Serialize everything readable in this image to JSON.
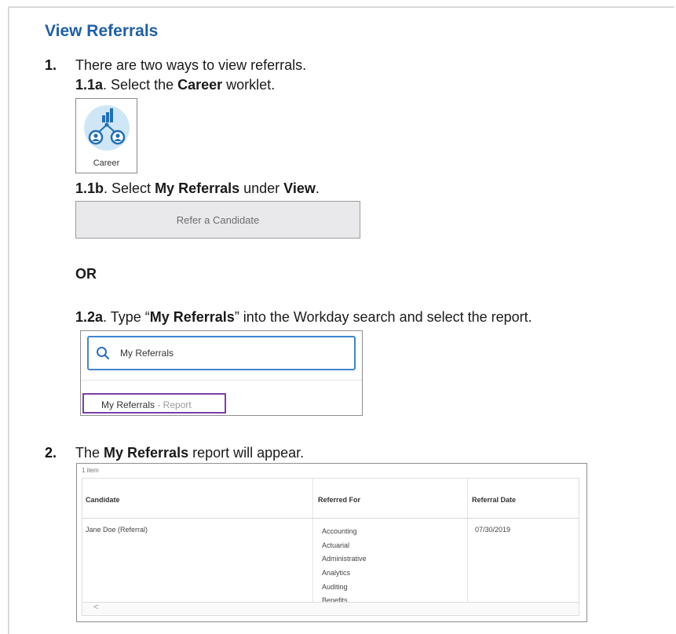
{
  "section_title": "View Referrals",
  "step1": {
    "number": "1.",
    "text": "There are two ways to view referrals."
  },
  "step1_1a": {
    "prefix": "1.1a",
    "text1": ". Select the ",
    "bold": "Career",
    "text2": " worklet."
  },
  "career_worklet": {
    "label": "Career",
    "icon": "career-network-icon",
    "icon_bg_color": "#cfe6f7",
    "icon_color": "#1f6fb5"
  },
  "step1_1b": {
    "prefix": "1.1b",
    "text1": ". Select ",
    "bold1": "My Referrals",
    "text2": " under ",
    "bold2": "View",
    "text3": "."
  },
  "refer_button": {
    "label": "Refer a Candidate"
  },
  "or_text": "OR",
  "step1_2a": {
    "prefix": "1.2a",
    "text1": ". Type “",
    "bold": "My Referrals",
    "text2": "” into the Workday search and select the report."
  },
  "search": {
    "value": "My Referrals",
    "icon": "search-icon",
    "border_color": "#3f86d1"
  },
  "search_result": {
    "name": "My Referrals",
    "type": " - Report",
    "highlight_color": "#7b3fa8"
  },
  "step2": {
    "number": "2.",
    "text1": "The ",
    "bold": "My Referrals",
    "text2": " report will appear."
  },
  "report": {
    "count": "1 item",
    "columns": [
      "Candidate",
      "Referred For",
      "Referral Date"
    ],
    "rows": [
      {
        "candidate": "Jane Doe (Referral)",
        "referred_for": [
          "Accounting",
          "Actuarial",
          "Administrative",
          "Analytics",
          "Auditing",
          "Benefits"
        ],
        "referral_date": "07/30/2019"
      }
    ],
    "scroll_left": "<"
  }
}
